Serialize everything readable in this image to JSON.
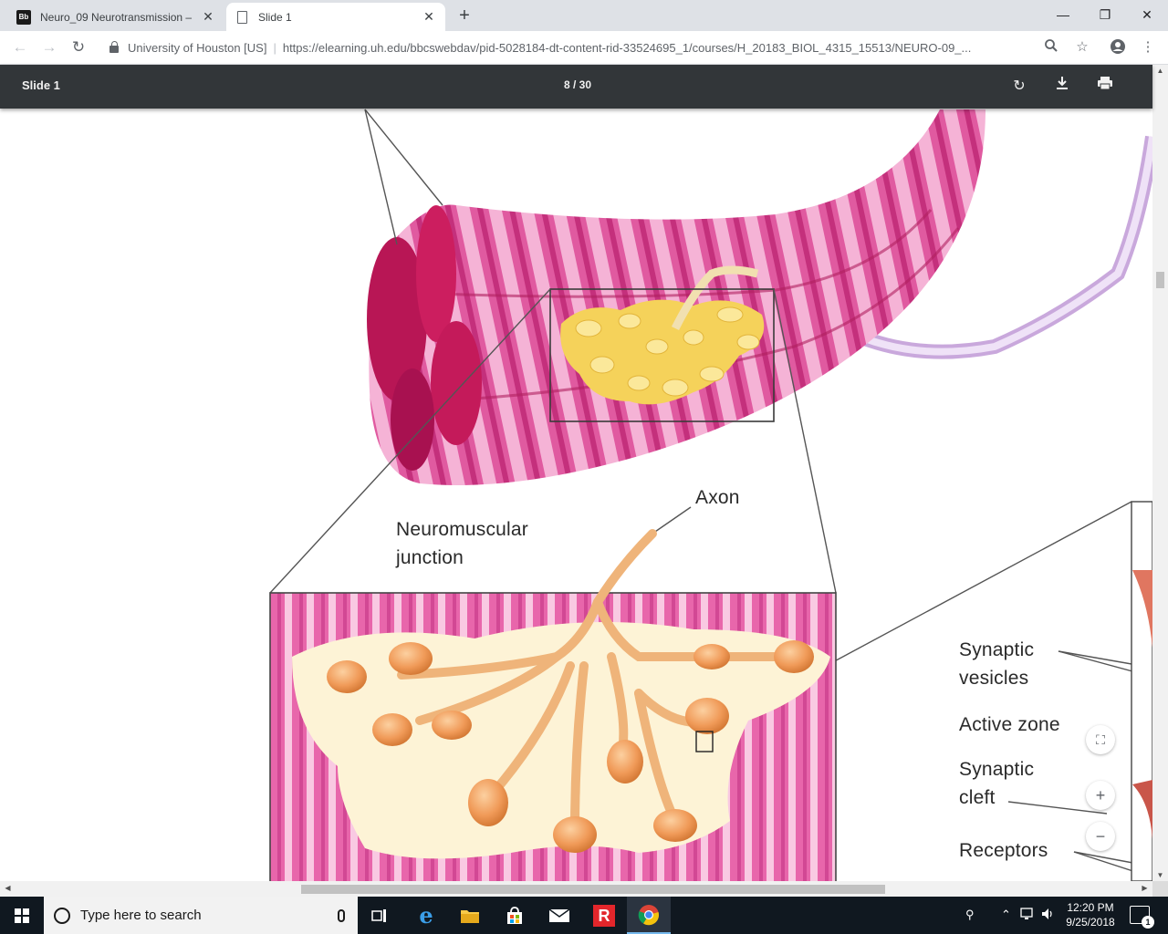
{
  "browser": {
    "tabs": [
      {
        "title": "Neuro_09 Neurotransmission – ",
        "favicon": "Bb",
        "active": false
      },
      {
        "title": "Slide 1",
        "favicon": "page-icon",
        "active": true
      }
    ],
    "new_tab_label": "+",
    "window_controls": {
      "minimize": "—",
      "restore": "❐",
      "close": "✕"
    },
    "nav": {
      "back": "←",
      "forward": "→",
      "reload": "↻"
    },
    "site_identity": "University of Houston [US]",
    "separator": "|",
    "url": "https://elearning.uh.edu/bbcswebdav/pid-5028184-dt-content-rid-33524695_1/courses/H_20183_BIOL_4315_15513/NEURO-09_...",
    "toolbar_icons": [
      "zoom-icon",
      "star-icon",
      "account-icon",
      "menu-icon"
    ]
  },
  "pdf_viewer": {
    "title": "Slide 1",
    "page_display": "8 / 30",
    "current_page": 8,
    "total_pages": 30,
    "buttons": [
      "rotate-icon",
      "download-icon",
      "print-icon"
    ],
    "zoom_buttons": {
      "fit": "⛶",
      "zoom_in": "+",
      "zoom_out": "−"
    }
  },
  "slide": {
    "labels": {
      "axon": "Axon",
      "nmj_line1": "Neuromuscular",
      "nmj_line2": "junction",
      "synaptic_vesicles_1": "Synaptic",
      "synaptic_vesicles_2": "vesicles",
      "active_zone": "Active zone",
      "synaptic_cleft_1": "Synaptic",
      "synaptic_cleft_2": "cleft",
      "receptors": "Receptors"
    }
  },
  "taskbar": {
    "search_placeholder": "Type here to search",
    "apps": [
      "task-view-icon",
      "edge-icon",
      "file-explorer-icon",
      "store-icon",
      "mail-icon",
      "r-app-icon",
      "chrome-icon"
    ],
    "clock_time": "12:20 PM",
    "clock_date": "9/25/2018",
    "notification_count": "1"
  },
  "colors": {
    "pdf_toolbar": "#323639",
    "muscle_pink": "#d8308a",
    "nerve_terminal": "#f0c060",
    "bouton_orange": "#f0a060",
    "taskbar": "#101820"
  }
}
